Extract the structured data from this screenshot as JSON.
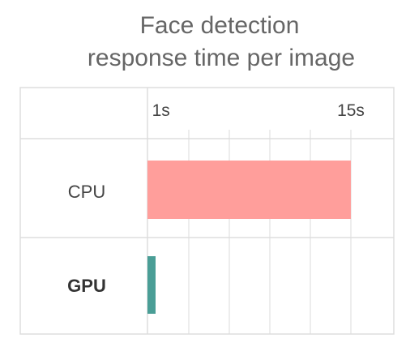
{
  "chart_data": {
    "type": "bar",
    "orientation": "horizontal",
    "title": [
      "Face detection",
      "response time per image"
    ],
    "categories": [
      "CPU",
      "GPU"
    ],
    "category_emphasis": [
      "normal",
      "bold"
    ],
    "values": [
      15,
      0.2
    ],
    "unit": "s",
    "x_ticks": [
      {
        "value": 1,
        "label": "1s"
      },
      {
        "value": 15,
        "label": "15s"
      }
    ],
    "xlim": [
      0,
      15
    ],
    "grid": true,
    "legend": "none",
    "colors": [
      "#ff9e9b",
      "#4a9e96"
    ]
  }
}
